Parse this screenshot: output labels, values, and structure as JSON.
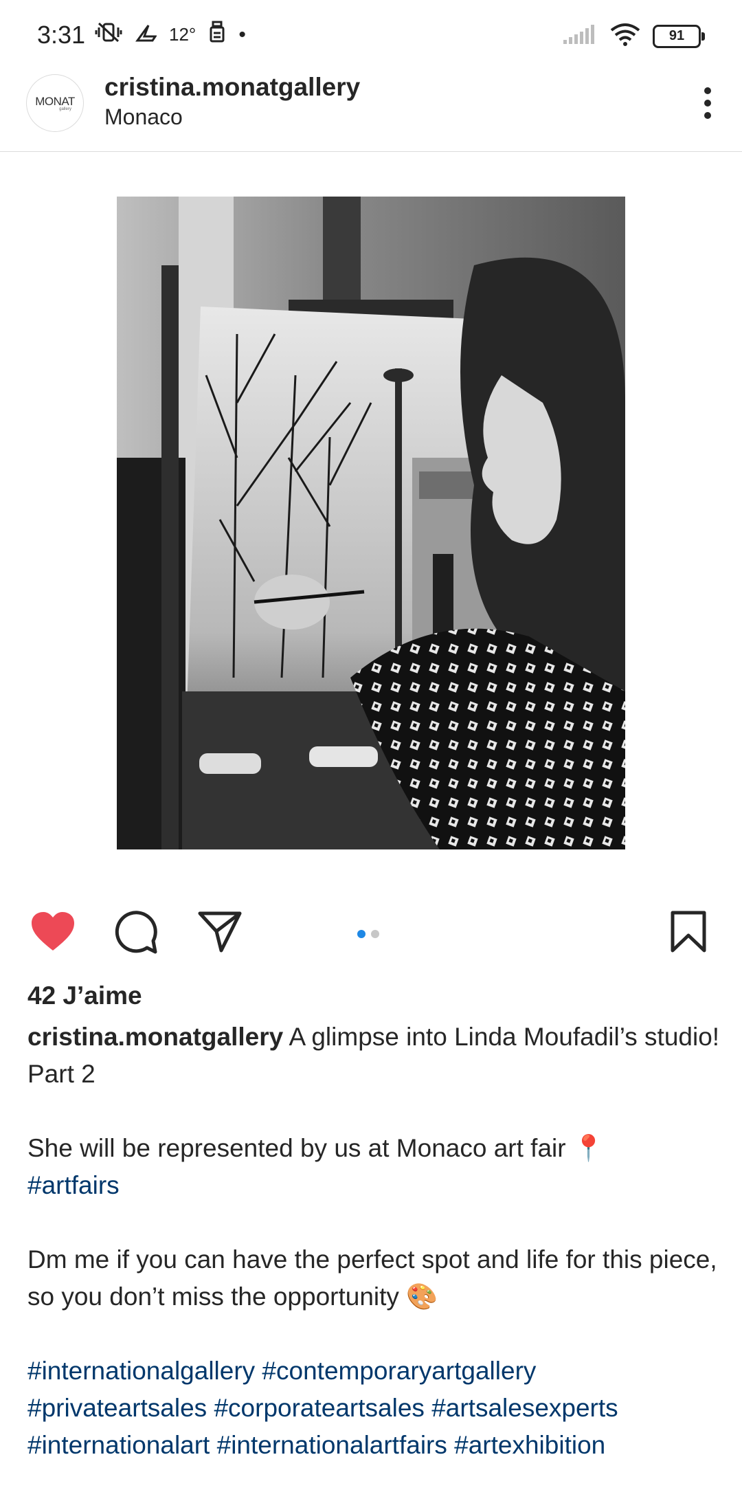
{
  "status_bar": {
    "time": "3:31",
    "temperature": "12°",
    "battery": "91",
    "icons": [
      "vibrate-off-icon",
      "weather-icon",
      "alarm-icon",
      "signal-icon",
      "wifi-icon",
      "battery-icon"
    ]
  },
  "post": {
    "username": "cristina.monatgallery",
    "location": "Monaco",
    "avatar_text": "MONAT",
    "avatar_subtext": "gallery",
    "likes": "42 J’aime",
    "carousel": {
      "count": 2,
      "active": 0
    },
    "caption": {
      "user": "cristina.monatgallery",
      "text1": "A glimpse into Linda Moufadil’s studio! Part 2",
      "text2": "She will be represented by us at Monaco art fair 📍",
      "hashtag1": "#artfairs",
      "text3": "Dm me if you can have the perfect spot and life for this piece, so you don’t miss the opportunity 🎨",
      "hashtags_line1": "#internationalgallery #contemporaryartgallery",
      "hashtags_line2": "#privateartsales #corporateartsales #artsalesexperts",
      "hashtags_line3": "#internationalart #internationalartfairs #artexhibition"
    }
  },
  "colors": {
    "like_red": "#ed4956",
    "hashtag_blue": "#00376b",
    "dot_active": "#1e88e5"
  }
}
